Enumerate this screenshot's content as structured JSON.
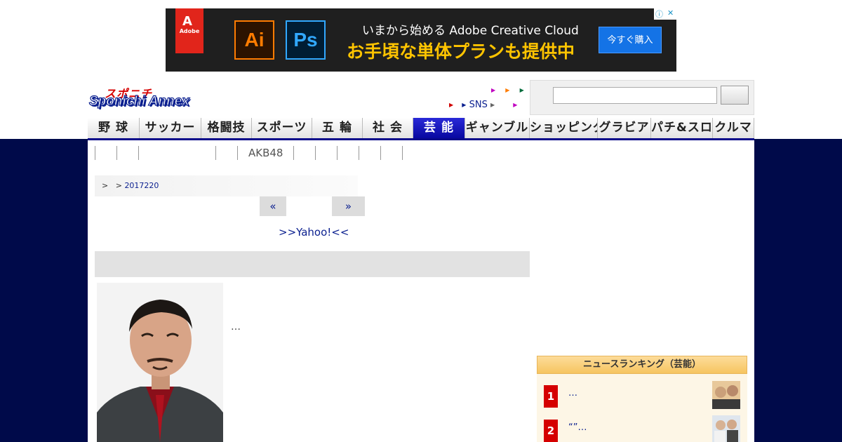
{
  "ad": {
    "logo_text": "Adobe",
    "app1": "Ai",
    "app2": "Ps",
    "headline": "いまから始める Adobe Creative Cloud",
    "subline": "お手頃な単体プランも提供中",
    "cta": "今すぐ購入",
    "choices_icon": "ⓘ",
    "close_icon": "✕"
  },
  "logo": {
    "top": "スポニチ",
    "main": "Sponichi Annex"
  },
  "header_links": {
    "sns": "SNS",
    "arrow": "▶"
  },
  "nav": {
    "items": [
      {
        "label": "野 球",
        "width": 74
      },
      {
        "label": "サッカー",
        "width": 88
      },
      {
        "label": "格闘技",
        "width": 72
      },
      {
        "label": "スポーツ",
        "width": 86
      },
      {
        "label": "五 輪",
        "width": 72
      },
      {
        "label": "社 会",
        "width": 72
      },
      {
        "label": "芸 能",
        "width": 74,
        "active": true
      },
      {
        "label": "ギャンブル",
        "width": 92
      },
      {
        "label": "ショッピング",
        "width": 97
      },
      {
        "label": "グラビア",
        "width": 76
      },
      {
        "label": "パチ&スロ",
        "width": 88
      },
      {
        "label": "クルマ",
        "width": 59
      }
    ]
  },
  "subnav": {
    "items": [
      "",
      "",
      "",
      "",
      "AKB48",
      "",
      "",
      "",
      "",
      ""
    ]
  },
  "breadcrumb": {
    "sep1": ">",
    "sep2": ">",
    "date": "2017220"
  },
  "pager": {
    "prev": "«",
    "next": "»"
  },
  "yahoo_link": ">>Yahoo!<<",
  "article": {
    "lead": "…"
  },
  "ranking": {
    "title": "ニュースランキング（芸能）",
    "items": [
      {
        "rank": "1",
        "text": "…"
      },
      {
        "rank": "2",
        "text": "“”…"
      }
    ]
  },
  "colors": {
    "background": "#000a4a",
    "accent": "#0a0a8a",
    "logo_red": "#d60000",
    "rank_red": "#d50000"
  }
}
